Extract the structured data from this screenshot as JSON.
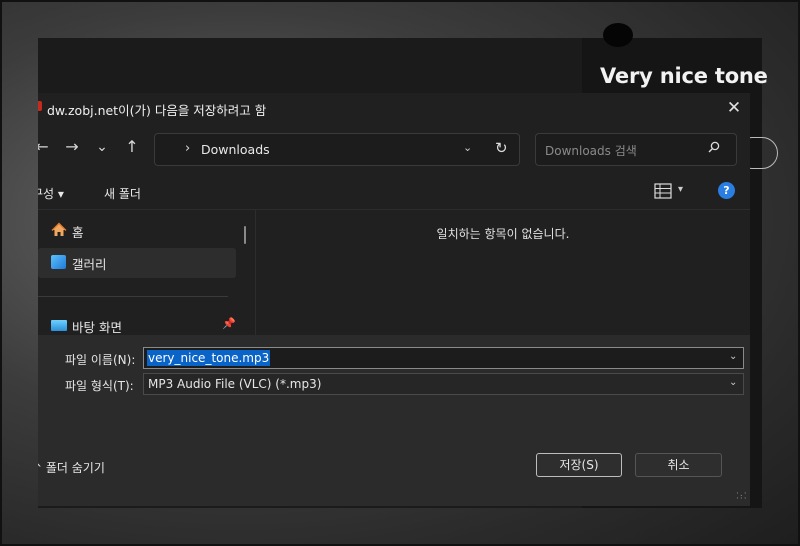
{
  "background": {
    "video_title": "Very nice tone"
  },
  "dialog": {
    "title": "dw.zobj.net이(가) 다음을 저장하려고 함",
    "close_glyph": "✕",
    "nav": {
      "back_glyph": "←",
      "forward_glyph": "→",
      "recent_glyph": "⌄",
      "up_glyph": "↑"
    },
    "address": {
      "chevron": "›",
      "location": "Downloads",
      "dropdown_glyph": "⌄",
      "refresh_glyph": "↻"
    },
    "search": {
      "placeholder": "Downloads 검색",
      "icon": "search-icon"
    },
    "commands": {
      "organize": "구성 ▾",
      "new_folder": "새 폴더",
      "view_dropdown": "▾",
      "help": "?"
    },
    "navigation_pane": {
      "items": [
        {
          "label": "홈",
          "icon": "home-icon"
        },
        {
          "label": "갤러리",
          "icon": "gallery-icon"
        },
        {
          "label": "바탕 화면",
          "icon": "desktop-icon",
          "pinned": true
        }
      ]
    },
    "content": {
      "empty_message": "일치하는 항목이 없습니다."
    },
    "footer": {
      "filename_label": "파일 이름(N):",
      "filename_value": "very_nice_tone.mp3",
      "filetype_label": "파일 형식(T):",
      "filetype_value": "MP3 Audio File (VLC) (*.mp3)",
      "dropdown_glyph": "⌄",
      "hide_folders": "폴더 숨기기",
      "save_button": "저장(S)",
      "cancel_button": "취소"
    }
  },
  "colors": {
    "dialog_bg": "#202020",
    "footer_bg": "#2b2b2b",
    "selection": "#0a64c8",
    "help_accent": "#2a7de1"
  }
}
